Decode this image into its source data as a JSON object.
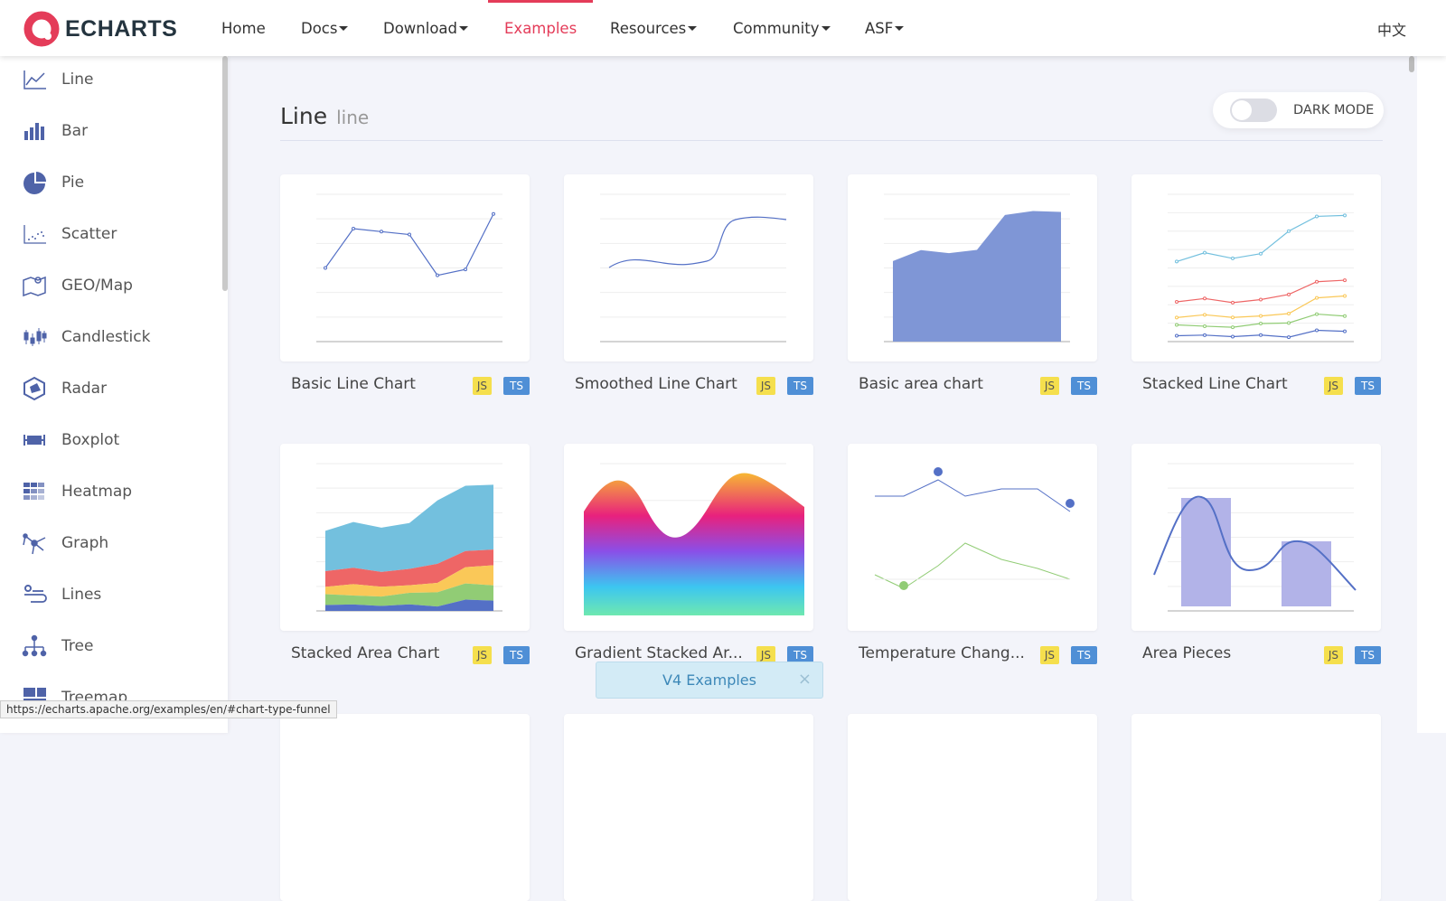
{
  "header": {
    "logo_text": "ECHARTS",
    "nav": [
      {
        "label": "Home",
        "dropdown": false
      },
      {
        "label": "Docs",
        "dropdown": true
      },
      {
        "label": "Download",
        "dropdown": true
      },
      {
        "label": "Examples",
        "dropdown": false,
        "active": true
      },
      {
        "label": "Resources",
        "dropdown": true
      },
      {
        "label": "Community",
        "dropdown": true
      },
      {
        "label": "ASF",
        "dropdown": true
      }
    ],
    "language": "中文"
  },
  "sidebar": {
    "items": [
      {
        "label": "Line",
        "icon": "line-chart-icon"
      },
      {
        "label": "Bar",
        "icon": "bar-chart-icon"
      },
      {
        "label": "Pie",
        "icon": "pie-chart-icon"
      },
      {
        "label": "Scatter",
        "icon": "scatter-icon"
      },
      {
        "label": "GEO/Map",
        "icon": "map-icon"
      },
      {
        "label": "Candlestick",
        "icon": "candlestick-icon"
      },
      {
        "label": "Radar",
        "icon": "radar-icon"
      },
      {
        "label": "Boxplot",
        "icon": "boxplot-icon"
      },
      {
        "label": "Heatmap",
        "icon": "heatmap-icon"
      },
      {
        "label": "Graph",
        "icon": "graph-icon"
      },
      {
        "label": "Lines",
        "icon": "lines-icon"
      },
      {
        "label": "Tree",
        "icon": "tree-icon"
      },
      {
        "label": "Treemap",
        "icon": "treemap-icon"
      }
    ]
  },
  "main": {
    "title": "Line",
    "subtitle": "line",
    "dark_mode_label": "DARK MODE",
    "dark_mode_on": false,
    "cards": [
      {
        "title": "Basic Line Chart",
        "js": "JS",
        "ts": "TS"
      },
      {
        "title": "Smoothed Line Chart",
        "js": "JS",
        "ts": "TS"
      },
      {
        "title": "Basic area chart",
        "js": "JS",
        "ts": "TS"
      },
      {
        "title": "Stacked Line Chart",
        "js": "JS",
        "ts": "TS"
      },
      {
        "title": "Stacked Area Chart",
        "js": "JS",
        "ts": "TS"
      },
      {
        "title": "Gradient Stacked Ar...",
        "js": "JS",
        "ts": "TS"
      },
      {
        "title": "Temperature Chang...",
        "js": "JS",
        "ts": "TS"
      },
      {
        "title": "Area Pieces",
        "js": "JS",
        "ts": "TS"
      }
    ]
  },
  "toast": {
    "label": "V4 Examples",
    "close": "×"
  },
  "status_url": "https://echarts.apache.org/examples/en/#chart-type-funnel",
  "colors": {
    "accent": "#e43c59",
    "series": "#5470c6",
    "js_badge": "#f5df4d",
    "ts_badge": "#4f8fd6"
  }
}
